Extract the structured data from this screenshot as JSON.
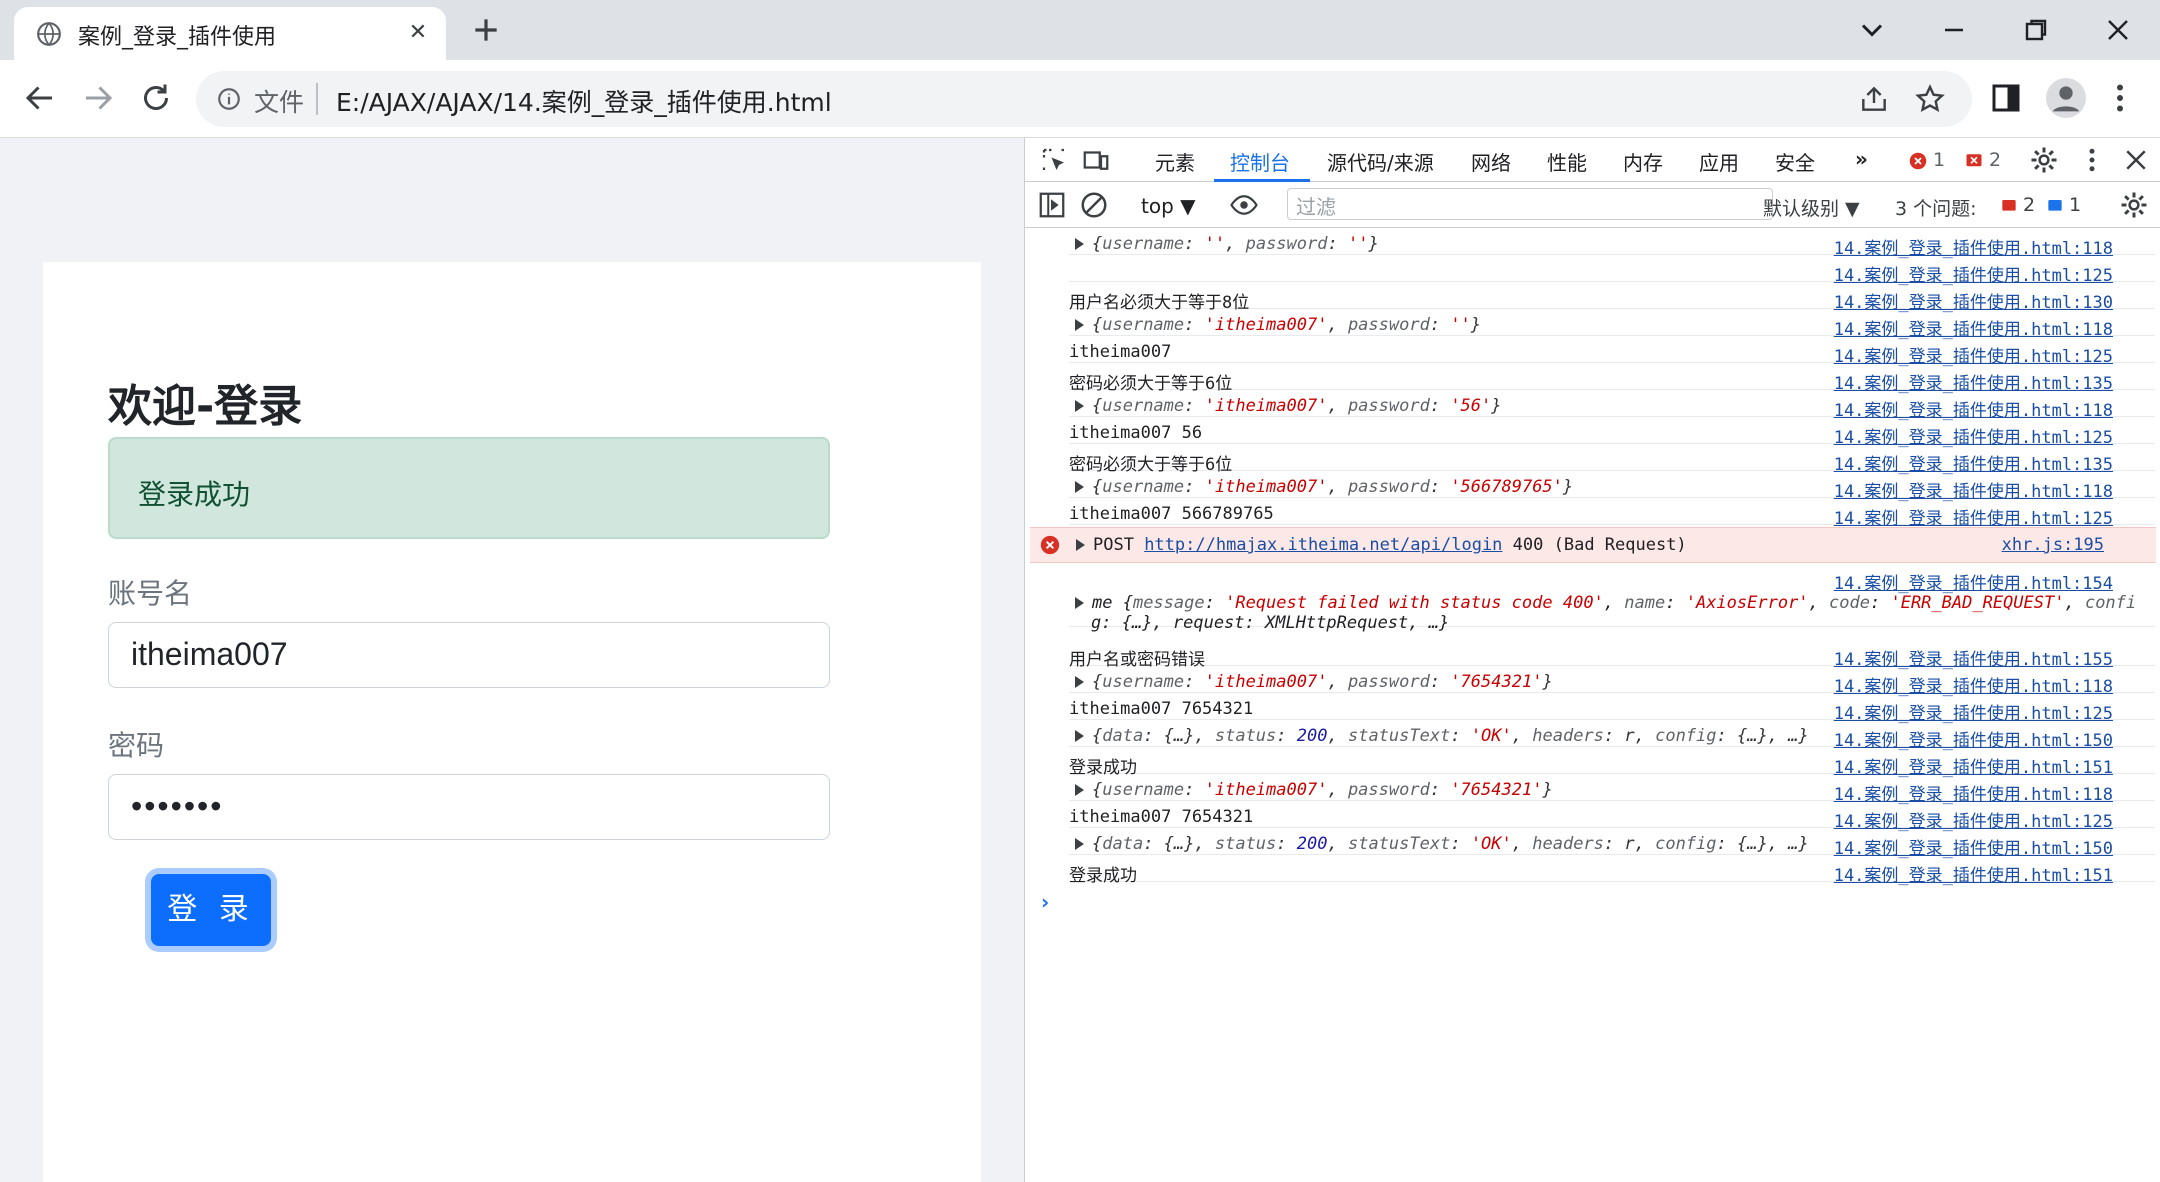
{
  "browser": {
    "tab_title": "案例_登录_插件使用",
    "omnibox_label": "文件",
    "url": "E:/AJAX/AJAX/14.案例_登录_插件使用.html"
  },
  "page": {
    "title": "欢迎-登录",
    "alert_text": "登录成功",
    "username_label": "账号名",
    "username_value": "itheima007",
    "password_label": "密码",
    "password_value": "•••••••",
    "login_button": "登 录"
  },
  "devtools": {
    "tabs": [
      "元素",
      "控制台",
      "源代码/来源",
      "网络",
      "性能",
      "内存",
      "应用",
      "安全"
    ],
    "active_tab": "控制台",
    "error_count": "1",
    "warning_count": "2",
    "context": "top",
    "filter_placeholder": "过滤",
    "levels_label": "默认级别",
    "issues_label": "3 个问题:",
    "issues_error_count": "2",
    "issues_info_count": "1"
  },
  "console": {
    "rows": [
      {
        "kind": "obj",
        "user": "''",
        "pass": "''",
        "src": "14.案例_登录_插件使用.html:118"
      },
      {
        "kind": "text",
        "text": "",
        "src": "14.案例_登录_插件使用.html:125"
      },
      {
        "kind": "text",
        "text": "用户名必须大于等于8位",
        "src": "14.案例_登录_插件使用.html:130"
      },
      {
        "kind": "obj",
        "user": "'itheima007'",
        "pass": "''",
        "src": "14.案例_登录_插件使用.html:118"
      },
      {
        "kind": "text",
        "text": "itheima007",
        "src": "14.案例_登录_插件使用.html:125"
      },
      {
        "kind": "text",
        "text": "密码必须大于等于6位",
        "src": "14.案例_登录_插件使用.html:135"
      },
      {
        "kind": "obj",
        "user": "'itheima007'",
        "pass": "'56'",
        "src": "14.案例_登录_插件使用.html:118"
      },
      {
        "kind": "text",
        "text": "itheima007 56",
        "src": "14.案例_登录_插件使用.html:125"
      },
      {
        "kind": "text",
        "text": "密码必须大于等于6位",
        "src": "14.案例_登录_插件使用.html:135"
      },
      {
        "kind": "obj",
        "user": "'itheima007'",
        "pass": "'566789765'",
        "src": "14.案例_登录_插件使用.html:118"
      },
      {
        "kind": "text",
        "text": "itheima007 566789765",
        "src": "14.案例_登录_插件使用.html:125"
      }
    ],
    "error": {
      "method": "POST",
      "url": "http://hmajax.itheima.net/api/login",
      "status": "400 (Bad Request)",
      "src": "xhr.js:195"
    },
    "axios_error": {
      "src": "14.案例_登录_插件使用.html:154",
      "prefix": "me",
      "message": "'Request failed with status code 400'",
      "name": "'AxiosError'",
      "code": "'ERR_BAD_REQUEST'",
      "tail_fragment": "confi",
      "line2": "g: {…}, request: XMLHttpRequest, …}"
    },
    "rows2": [
      {
        "kind": "text",
        "text": "用户名或密码错误",
        "src": "14.案例_登录_插件使用.html:155"
      },
      {
        "kind": "obj",
        "user": "'itheima007'",
        "pass": "'7654321'",
        "src": "14.案例_登录_插件使用.html:118"
      },
      {
        "kind": "text",
        "text": "itheima007 7654321",
        "src": "14.案例_登录_插件使用.html:125"
      },
      {
        "kind": "resp",
        "status": "200",
        "statusText": "'OK'",
        "src": "14.案例_登录_插件使用.html:150"
      },
      {
        "kind": "text",
        "text": "登录成功",
        "src": "14.案例_登录_插件使用.html:151"
      },
      {
        "kind": "obj",
        "user": "'itheima007'",
        "pass": "'7654321'",
        "src": "14.案例_登录_插件使用.html:118"
      },
      {
        "kind": "text",
        "text": "itheima007 7654321",
        "src": "14.案例_登录_插件使用.html:125"
      },
      {
        "kind": "resp",
        "status": "200",
        "statusText": "'OK'",
        "src": "14.案例_登录_插件使用.html:150"
      },
      {
        "kind": "text",
        "text": "登录成功",
        "src": "14.案例_登录_插件使用.html:151"
      }
    ]
  },
  "colors": {
    "primary": "#0d6efd",
    "alert_bg": "#d1e7dd",
    "devtools_accent": "#1a73e8",
    "error_bg": "#fce8e6"
  }
}
